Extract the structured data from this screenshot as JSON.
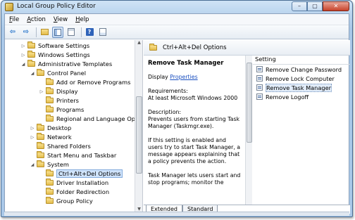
{
  "window": {
    "title": "Local Group Policy Editor",
    "close_glyph": "✕",
    "min_glyph": "–",
    "max_glyph": "▢"
  },
  "menu": [
    {
      "label_ul": "F",
      "label_rest": "ile"
    },
    {
      "label_ul": "A",
      "label_rest": "ction"
    },
    {
      "label_ul": "V",
      "label_rest": "iew"
    },
    {
      "label_ul": "H",
      "label_rest": "elp"
    }
  ],
  "toolbar": {
    "back_glyph": "⇦",
    "forward_glyph": "⇨",
    "help_glyph": "?"
  },
  "tree": [
    {
      "label": "Software Settings",
      "exp": "▷"
    },
    {
      "label": "Windows Settings",
      "exp": "▷"
    },
    {
      "label": "Administrative Templates",
      "exp": "◢"
    },
    {
      "label": "Control Panel",
      "exp": "◢"
    },
    {
      "label": "Add or Remove Programs",
      "exp": ""
    },
    {
      "label": "Display",
      "exp": "▷"
    },
    {
      "label": "Printers",
      "exp": ""
    },
    {
      "label": "Programs",
      "exp": ""
    },
    {
      "label": "Regional and Language Optio",
      "exp": ""
    },
    {
      "label": "Desktop",
      "exp": "▷"
    },
    {
      "label": "Network",
      "exp": "▷"
    },
    {
      "label": "Shared Folders",
      "exp": ""
    },
    {
      "label": "Start Menu and Taskbar",
      "exp": ""
    },
    {
      "label": "System",
      "exp": "◢"
    },
    {
      "label": "Ctrl+Alt+Del Options",
      "exp": ""
    },
    {
      "label": "Driver Installation",
      "exp": ""
    },
    {
      "label": "Folder Redirection",
      "exp": ""
    },
    {
      "label": "Group Policy",
      "exp": ""
    }
  ],
  "details": {
    "header": "Ctrl+Alt+Del Options",
    "policy_title": "Remove Task Manager",
    "display_label": "Display",
    "properties_link": "Properties",
    "requirements_label": "Requirements:",
    "requirements_value": "At least Microsoft Windows 2000",
    "description_label": "Description:",
    "description_text": "Prevents users from starting Task Manager (Taskmgr.exe).",
    "para2": "If this setting is enabled and users try to start Task Manager, a message appears explaining that a policy prevents the action.",
    "para3": "Task Manager lets users start and stop programs; monitor the"
  },
  "list": {
    "column": "Setting",
    "rows": [
      {
        "label": "Remove Change Password"
      },
      {
        "label": "Remove Lock Computer"
      },
      {
        "label": "Remove Task Manager"
      },
      {
        "label": "Remove Logoff"
      }
    ]
  },
  "tabs": {
    "extended": "Extended",
    "standard": "Standard"
  }
}
